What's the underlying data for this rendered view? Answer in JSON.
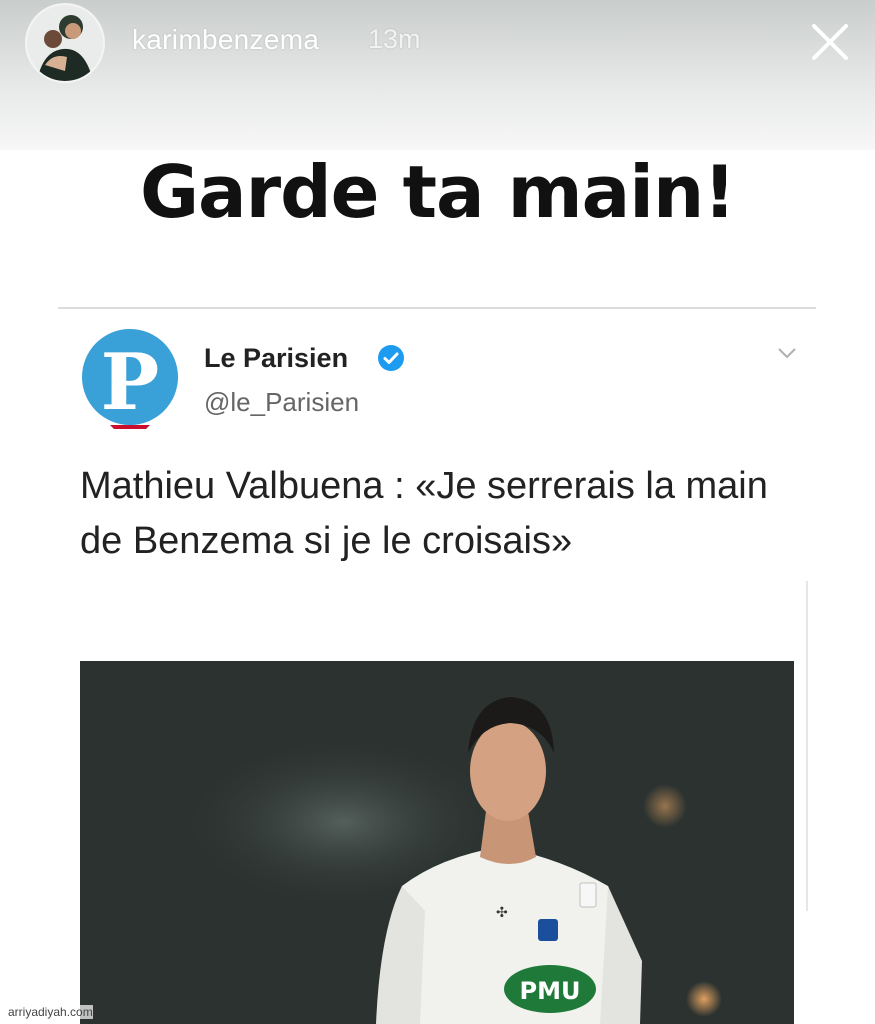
{
  "story": {
    "username": "karimbenzema",
    "time_ago": "13m",
    "caption": "Garde ta main!"
  },
  "tweet": {
    "display_name": "Le Parisien",
    "handle": "@le_Parisien",
    "text": "Mathieu Valbuena : «Je serrerais la main de Benzema si je le croisais»",
    "logo_letter": "P",
    "jersey_sponsor": "PMU"
  },
  "watermark": "arriyadiyah.com",
  "colors": {
    "logo_blue": "#3aa0d8",
    "logo_red": "#c8102e",
    "verified_blue": "#1d9bf0",
    "photo_bg": "#2b3230",
    "pmu_green": "#1f7a3a"
  },
  "icons": [
    "close-icon",
    "verified-badge-icon",
    "chevron-down-icon"
  ]
}
